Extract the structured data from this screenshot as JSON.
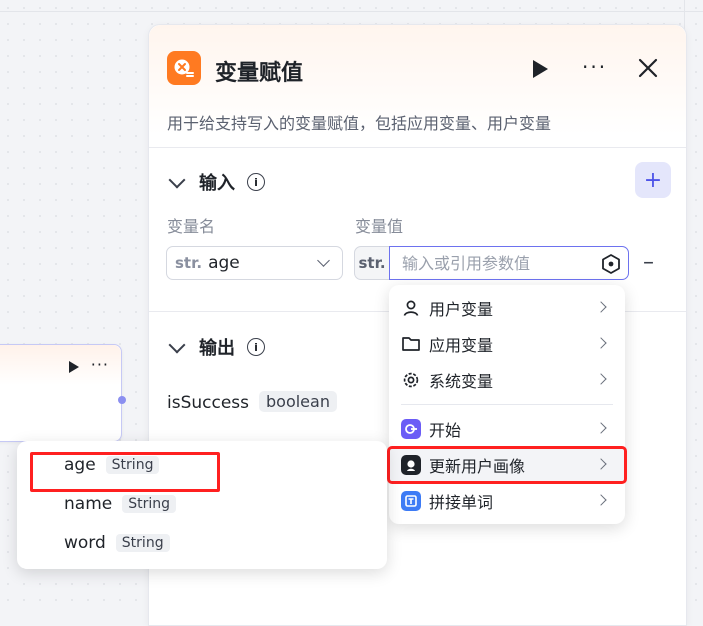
{
  "panel": {
    "title": "变量赋值",
    "description": "用于给支持写入的变量赋值，包括应用变量、用户变量"
  },
  "input_section": {
    "heading": "输入",
    "col_name_label": "变量名",
    "col_value_label": "变量值",
    "name_type_tag": "str.",
    "name_value": "age",
    "value_type_tag": "str.",
    "value_placeholder": "输入或引用参数值"
  },
  "output_section": {
    "heading": "输出",
    "field_name": "isSuccess",
    "field_type": "boolean"
  },
  "variable_menu": {
    "items": [
      {
        "label": "用户变量",
        "icon": "user-icon"
      },
      {
        "label": "应用变量",
        "icon": "folder-icon"
      },
      {
        "label": "系统变量",
        "icon": "gear-icon"
      },
      {
        "label": "开始",
        "icon": "start-node-icon",
        "color": "#6b5cf6"
      },
      {
        "label": "更新用户画像",
        "icon": "profile-node-icon",
        "color": "#1f2329"
      },
      {
        "label": "拼接单词",
        "icon": "text-node-icon",
        "color": "#3d7bf5"
      }
    ]
  },
  "field_popup": {
    "rows": [
      {
        "name": "age",
        "type": "String"
      },
      {
        "name": "name",
        "type": "String"
      },
      {
        "name": "word",
        "type": "String"
      }
    ]
  },
  "colors": {
    "accent": "#4d53e8",
    "brand_orange": "#ff7a21",
    "highlight_red": "#ff2020"
  }
}
